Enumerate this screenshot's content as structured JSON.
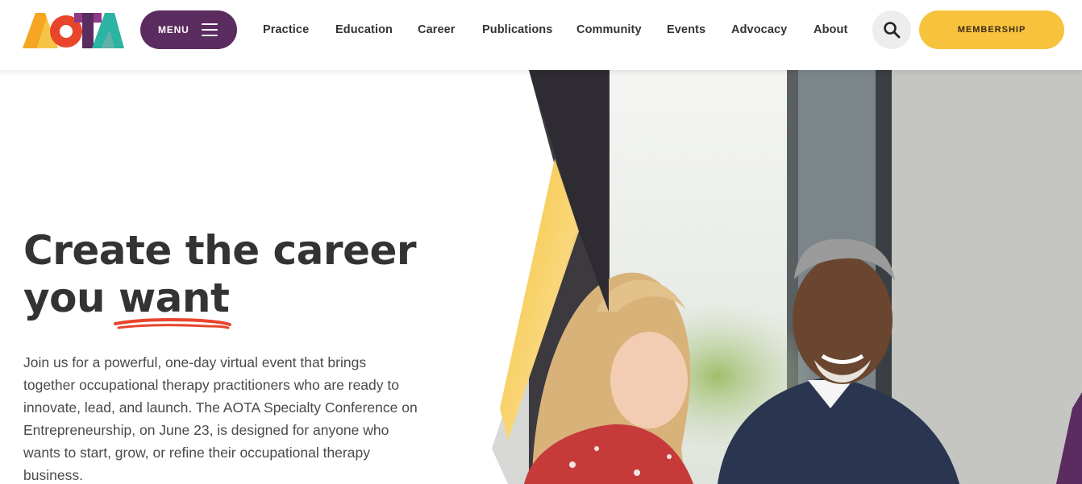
{
  "header": {
    "logo_text": "AOTA",
    "menu_label": "MENU",
    "nav": [
      {
        "label": "Practice"
      },
      {
        "label": "Education"
      },
      {
        "label": "Career"
      },
      {
        "label": "Publications"
      },
      {
        "label": "Community"
      },
      {
        "label": "Events"
      },
      {
        "label": "Advocacy"
      },
      {
        "label": "About"
      }
    ],
    "search_icon": "search-icon",
    "membership_label": "MEMBERSHIP"
  },
  "hero": {
    "title_line1": "Create the career",
    "title_word_you": "you",
    "title_word_want": "want",
    "body": "Join us for a powerful, one-day virtual event that brings together occupational therapy practitioners who are ready to innovate, lead, and launch. The AOTA Specialty Conference on Entrepreneurship, on June 23, is designed for anyone who wants to start, grow, or refine their occupational therapy business."
  },
  "colors": {
    "brand_purple": "#5b2c5f",
    "brand_yellow": "#f7c23c",
    "underline_red": "#e8452c",
    "text_dark": "#333333"
  }
}
